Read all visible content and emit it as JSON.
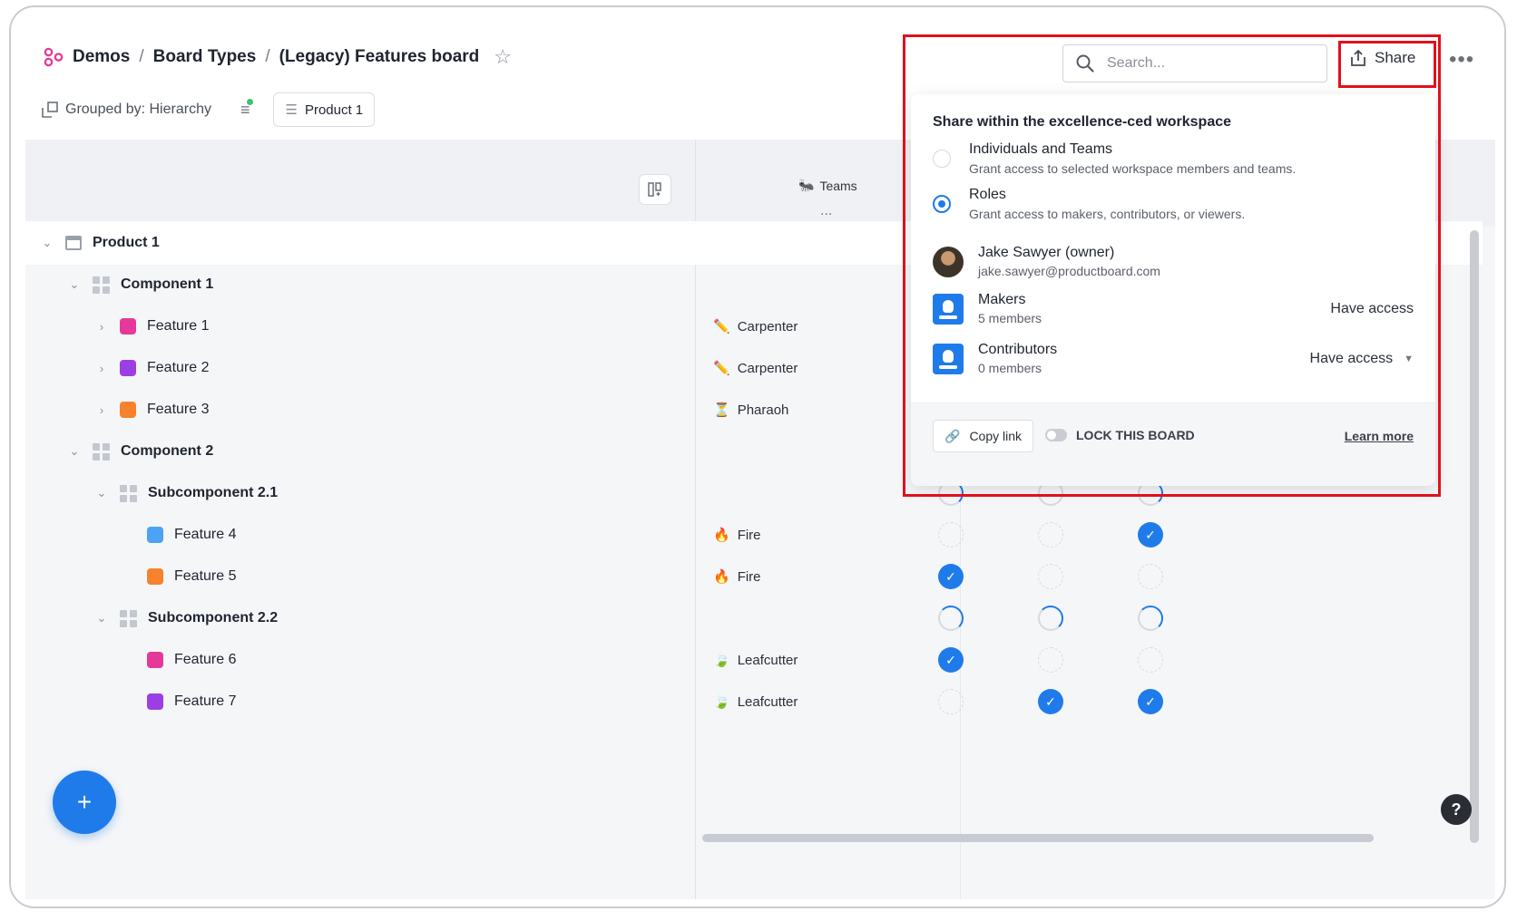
{
  "breadcrumb": {
    "items": [
      "Demos",
      "Board Types",
      "(Legacy) Features board"
    ],
    "separator": "/"
  },
  "toolbar": {
    "grouped_by": "Grouped by: Hierarchy",
    "product_filter": "Product 1"
  },
  "column": {
    "teams": "Teams",
    "more": "..."
  },
  "search": {
    "placeholder": "Search..."
  },
  "share": {
    "button_label": "Share",
    "title": "Share within the excellence-ced workspace",
    "options": [
      {
        "title": "Individuals and Teams",
        "desc": "Grant access to selected workspace members and teams.",
        "selected": false
      },
      {
        "title": "Roles",
        "desc": "Grant access to makers, contributors, or viewers.",
        "selected": true
      }
    ],
    "owner": {
      "name": "Jake Sawyer (owner)",
      "email": "jake.sawyer@productboard.com"
    },
    "roles": [
      {
        "name": "Makers",
        "count": "5 members",
        "access": "Have access"
      },
      {
        "name": "Contributors",
        "count": "0 members",
        "access": "Have access"
      }
    ],
    "copy_link": "Copy link",
    "lock_board": "LOCK THIS BOARD",
    "learn_more": "Learn more"
  },
  "rows": [
    {
      "label": "Product 1",
      "level": "product",
      "team": "",
      "team_icon": ""
    },
    {
      "label": "Component 1",
      "level": "component",
      "team": "",
      "team_icon": ""
    },
    {
      "label": "Feature 1",
      "level": "feature1",
      "color": "#e5399a",
      "team": "Carpenter",
      "team_icon": "pencil-icon"
    },
    {
      "label": "Feature 2",
      "level": "feature1",
      "color": "#9b3fe5",
      "team": "Carpenter",
      "team_icon": "pencil-icon"
    },
    {
      "label": "Feature 3",
      "level": "feature1",
      "color": "#f7812d",
      "team": "Pharaoh",
      "team_icon": "hourglass-icon"
    },
    {
      "label": "Component 2",
      "level": "component",
      "team": "",
      "team_icon": ""
    },
    {
      "label": "Subcomponent 2.1",
      "level": "subcomponent",
      "team": "",
      "team_icon": ""
    },
    {
      "label": "Feature 4",
      "level": "feature2",
      "color": "#4aa3f5",
      "team": "Fire",
      "team_icon": "fire-icon"
    },
    {
      "label": "Feature 5",
      "level": "feature2",
      "color": "#f7812d",
      "team": "Fire",
      "team_icon": "fire-icon"
    },
    {
      "label": "Subcomponent 2.2",
      "level": "subcomponent",
      "team": "",
      "team_icon": ""
    },
    {
      "label": "Feature 6",
      "level": "feature2",
      "color": "#e5399a",
      "team": "Leafcutter",
      "team_icon": "leaf-icon"
    },
    {
      "label": "Feature 7",
      "level": "feature2",
      "color": "#9b3fe5",
      "team": "Leafcutter",
      "team_icon": "leaf-icon"
    }
  ],
  "help_label": "?",
  "fab_label": "+"
}
